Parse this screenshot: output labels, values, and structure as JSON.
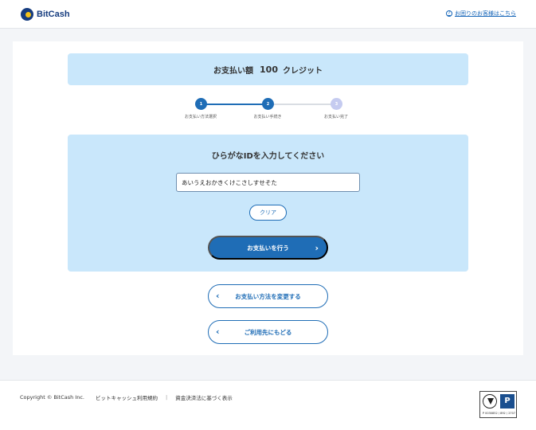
{
  "header": {
    "logo_text": "BitCash",
    "help_link": "お困りのお客様はこちら",
    "help_icon": "?"
  },
  "amount": {
    "label": "お支払い額",
    "value": "100",
    "unit": "クレジット"
  },
  "steps": [
    {
      "number": "1",
      "label": "お支払い方法選択",
      "state": "done"
    },
    {
      "number": "2",
      "label": "お支払い手続き",
      "state": "current"
    },
    {
      "number": "3",
      "label": "お支払い完了",
      "state": "todo"
    }
  ],
  "form": {
    "title": "ひらがなIDを入力してください",
    "id_value": "あいうえおかきくけこさしすせそた",
    "clear_label": "クリア",
    "pay_label": "お支払いを行う"
  },
  "actions": {
    "change_method_label": "お支払い方法を変更する",
    "return_label": "ご利用先にもどる"
  },
  "footer": {
    "copyright": "Copyright © BitCash Inc.",
    "terms_link": "ビットキャッシュ利用規約",
    "separator": "|",
    "law_link": "資金決済法に基づく表示",
    "badge_code": "P 0030852 / 892 / 2707",
    "badge_mark": "P"
  },
  "colors": {
    "primary": "#1f6db6",
    "panel": "#c9e7fb",
    "logo_blue": "#163c7f",
    "logo_yellow": "#f4c21a"
  }
}
